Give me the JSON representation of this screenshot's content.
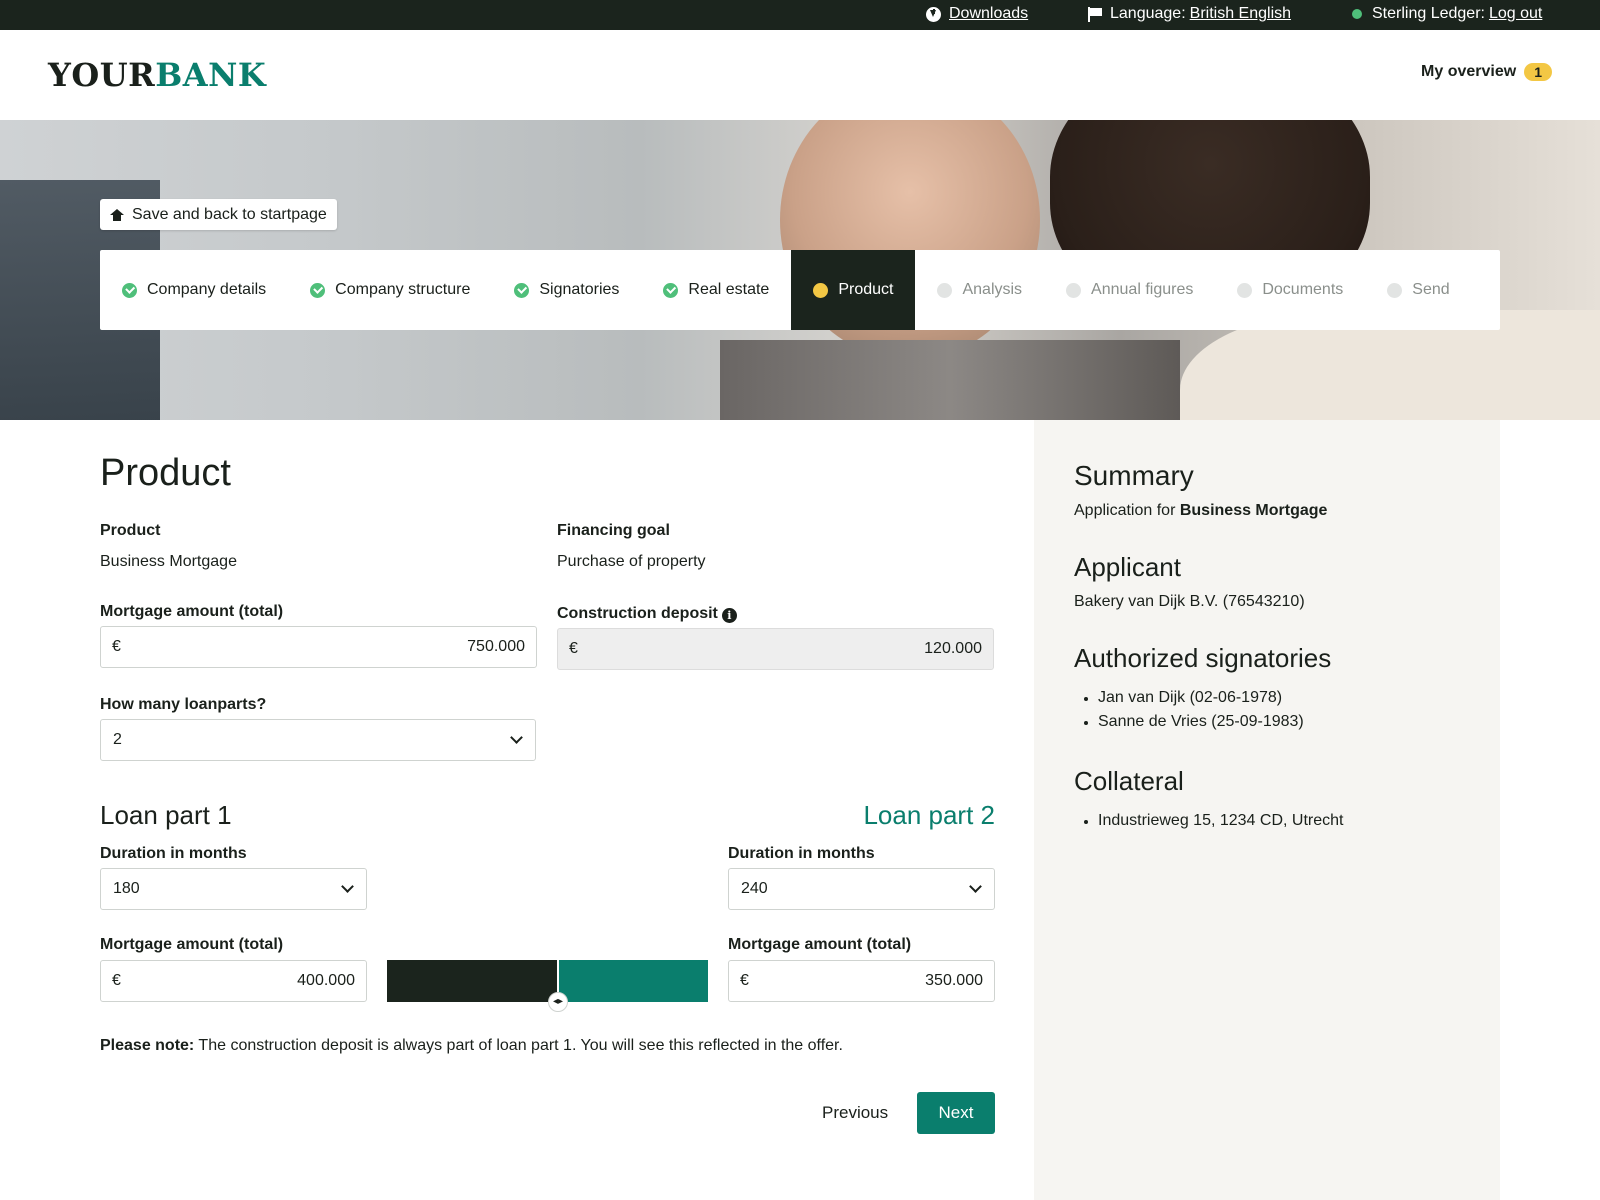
{
  "topbar": {
    "downloads_label": "Downloads",
    "language_prefix": "Language:",
    "language_value": "British English",
    "user_name": "Sterling Ledger:",
    "logout_label": "Log out"
  },
  "header": {
    "logo_part1": "YOUR",
    "logo_part2": "BANK",
    "overview_label": "My overview",
    "overview_badge": "1"
  },
  "hero": {
    "save_label": "Save and back to startpage"
  },
  "steps": [
    {
      "label": "Company details",
      "status": "done"
    },
    {
      "label": "Company structure",
      "status": "done"
    },
    {
      "label": "Signatories",
      "status": "done"
    },
    {
      "label": "Real estate",
      "status": "done"
    },
    {
      "label": "Product",
      "status": "active"
    },
    {
      "label": "Analysis",
      "status": "todo"
    },
    {
      "label": "Annual figures",
      "status": "todo"
    },
    {
      "label": "Documents",
      "status": "todo"
    },
    {
      "label": "Send",
      "status": "todo"
    }
  ],
  "main": {
    "title": "Product",
    "product_label": "Product",
    "product_value": "Business Mortgage",
    "goal_label": "Financing goal",
    "goal_value": "Purchase of property",
    "mortgage_label": "Mortgage amount (total)",
    "mortgage_currency": "€",
    "mortgage_value": "750.000",
    "deposit_label": "Construction deposit",
    "deposit_currency": "€",
    "deposit_value": "120.000",
    "loanparts_label": "How many loanparts?",
    "loanparts_value": "2",
    "note_bold": "Please note:",
    "note_text": " The construction deposit is always part of loan part 1. You will see this reflected in the offer.",
    "previous_label": "Previous",
    "next_label": "Next"
  },
  "loan_parts": [
    {
      "title": "Loan part 1",
      "duration_label": "Duration in months",
      "duration_value": "180",
      "amount_label": "Mortgage amount (total)",
      "currency": "€",
      "amount_value": "400.000"
    },
    {
      "title": "Loan part 2",
      "duration_label": "Duration in months",
      "duration_value": "240",
      "amount_label": "Mortgage amount (total)",
      "currency": "€",
      "amount_value": "350.000"
    }
  ],
  "split_slider": {
    "part1_fraction": 0.5333
  },
  "summary": {
    "title": "Summary",
    "application_prefix": "Application for",
    "application_product": "Business Mortgage",
    "applicant_title": "Applicant",
    "applicant_value": "Bakery van Dijk B.V. (76543210)",
    "signatories_title": "Authorized signatories",
    "signatories": [
      "Jan van Dijk (02-06-1978)",
      "Sanne de Vries (25-09-1983)"
    ],
    "collateral_title": "Collateral",
    "collateral": [
      "Industrieweg 15, 1234 CD, Utrecht"
    ]
  },
  "colors": {
    "dark": "#1b241d",
    "brand_teal": "#0a7e6d",
    "done_green": "#4fbf7a",
    "active_yellow": "#f3c744"
  }
}
